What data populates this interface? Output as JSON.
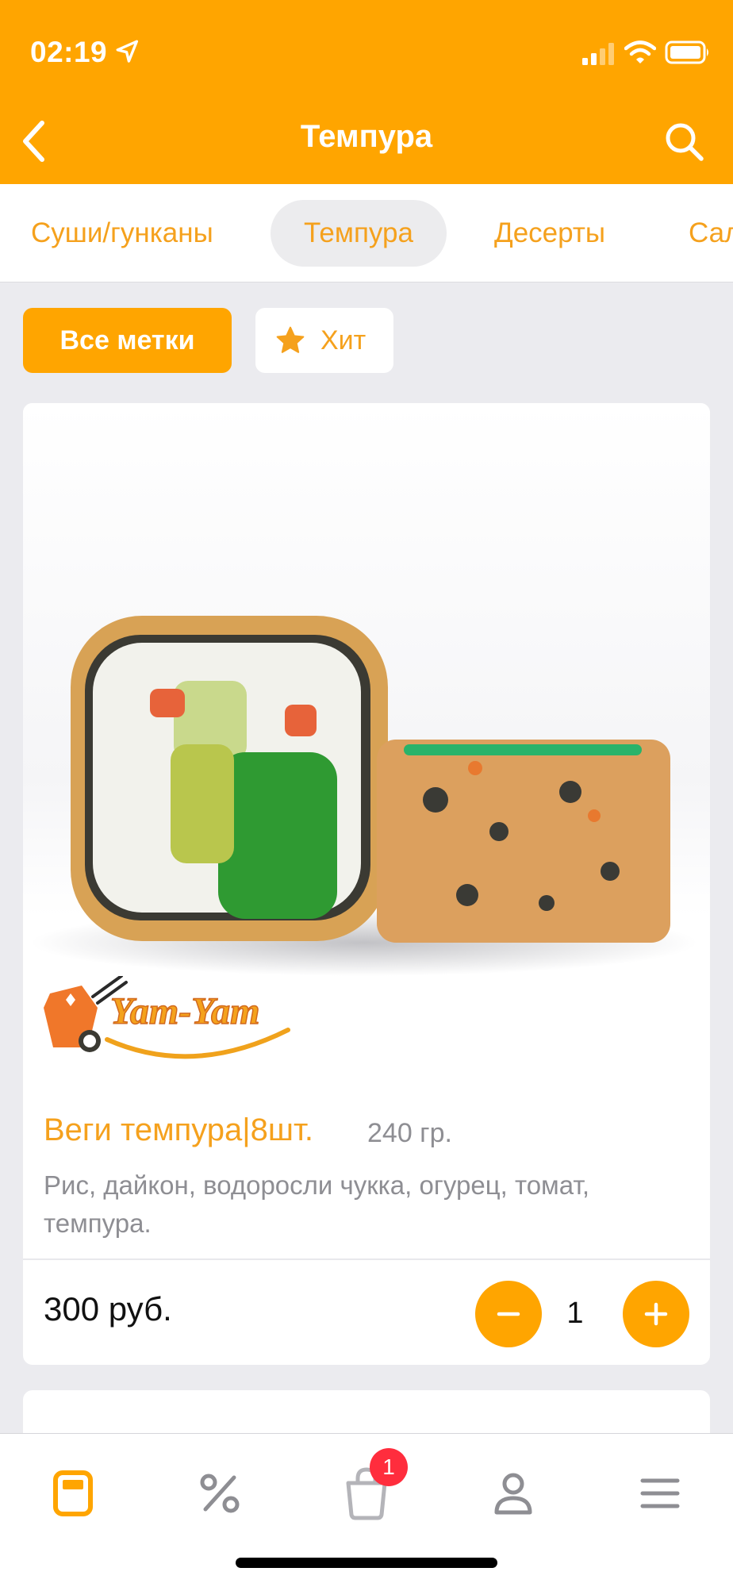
{
  "status_bar": {
    "time": "02:19"
  },
  "header": {
    "title": "Темпура"
  },
  "category_tabs": [
    {
      "label": "Суши/гунканы",
      "active": false
    },
    {
      "label": "Темпура",
      "active": true
    },
    {
      "label": "Десерты",
      "active": false
    },
    {
      "label": "Салаты",
      "active": false
    }
  ],
  "filters": {
    "all_label": "Все метки",
    "hit_label": "Хит"
  },
  "product": {
    "name": "Веги темпура|8шт.",
    "weight": "240 гр.",
    "description": "Рис, дайкон, водоросли чукка, огурец, томат, темпура.",
    "price": "300 руб.",
    "quantity": "1",
    "logo_text": "Yam-Yam"
  },
  "bottom_nav": {
    "items": [
      "menu-icon",
      "percent-icon",
      "cart-icon",
      "profile-icon",
      "hamburger-icon"
    ],
    "cart_badge": "1"
  },
  "colors": {
    "accent": "#ffa500",
    "accent_text": "#f5a11d",
    "badge": "#ff2d3d"
  }
}
